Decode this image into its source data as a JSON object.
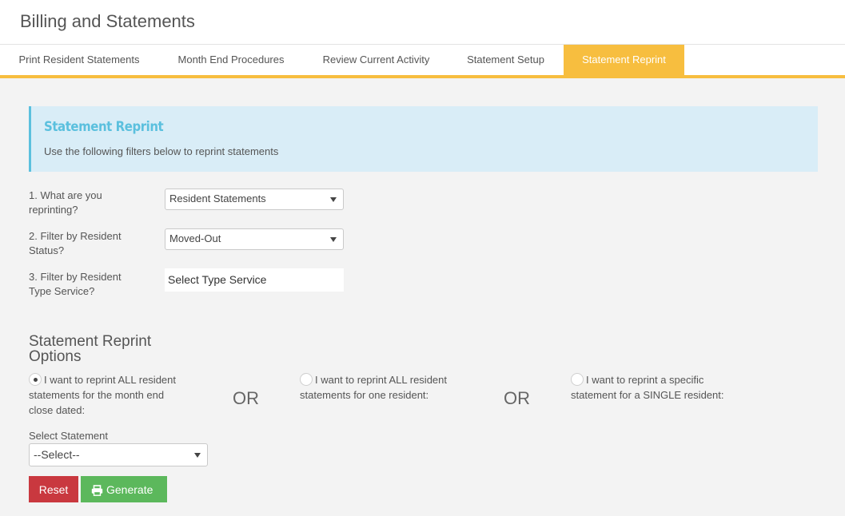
{
  "header": {
    "title": "Billing and Statements"
  },
  "tabs": [
    {
      "label": "Print Resident Statements"
    },
    {
      "label": "Month End Procedures"
    },
    {
      "label": "Review Current Activity"
    },
    {
      "label": "Statement Setup"
    },
    {
      "label": "Statement Reprint"
    }
  ],
  "active_tab": "Statement Reprint",
  "accent_color": "#f7be3f",
  "info": {
    "title": "Statement Reprint",
    "text": "Use the following filters below to reprint statements"
  },
  "filters": {
    "reprint_label_1": "1. What are you",
    "reprint_label_2": "reprinting?",
    "reprint_value": "Resident Statements",
    "status_label_1": "2. Filter by Resident",
    "status_label_2": "Status?",
    "status_value": "Moved-Out",
    "type_label_1": "3. Filter by Resident",
    "type_label_2": "Type Service?",
    "type_value": "Select Type Service"
  },
  "options": {
    "title_1": "Statement Reprint",
    "title_2": "Options",
    "option1_line1": "I want to reprint ALL resident",
    "option1_line2": "statements for the month end",
    "option1_line3": "close dated:",
    "option2_line1": "I want to reprint ALL resident",
    "option2_line2": "statements for one resident:",
    "option3_line1": "I want to reprint a specific",
    "option3_line2": "statement for a SINGLE resident:",
    "or_text": "OR",
    "selected_option": 1
  },
  "statement": {
    "label": "Select Statement",
    "value": "--Select--"
  },
  "buttons": {
    "reset": "Reset",
    "generate": "Generate"
  }
}
